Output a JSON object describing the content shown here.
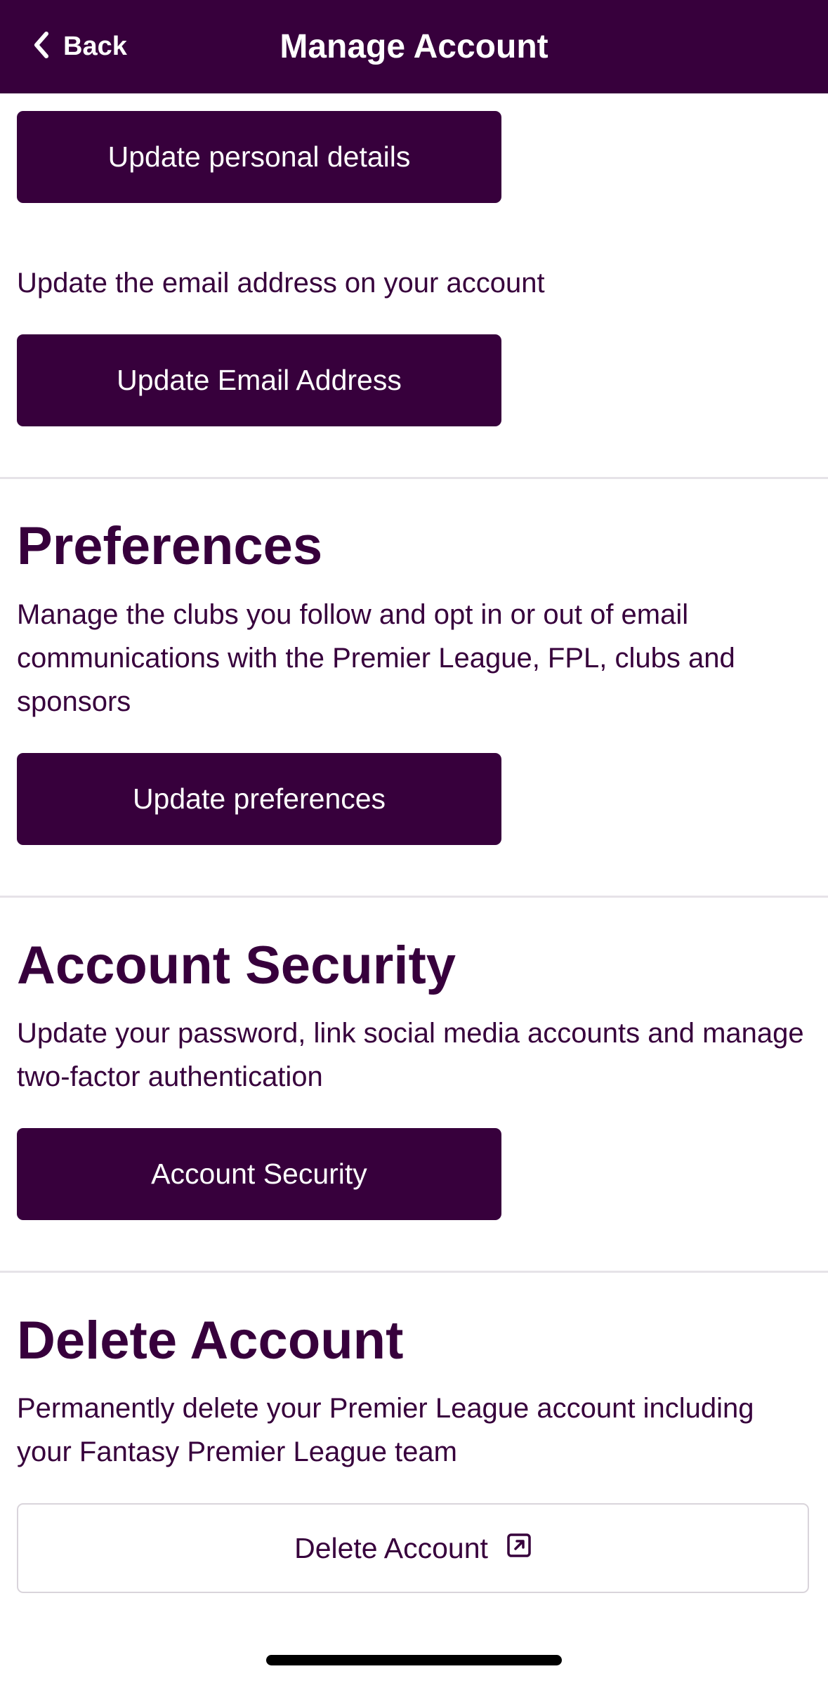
{
  "header": {
    "back_label": "Back",
    "title": "Manage Account"
  },
  "personal": {
    "button_label": "Update personal details"
  },
  "email": {
    "description": "Update the email address on your account",
    "button_label": "Update Email Address"
  },
  "preferences": {
    "title": "Preferences",
    "description": "Manage the clubs you follow and opt in or out of email communications with the Premier League, FPL, clubs and sponsors",
    "button_label": "Update preferences"
  },
  "security": {
    "title": "Account Security",
    "description": "Update your password, link social media accounts and manage two-factor authentication",
    "button_label": "Account Security"
  },
  "delete": {
    "title": "Delete Account",
    "description": "Permanently delete your Premier League account including your Fantasy Premier League team",
    "button_label": "Delete Account",
    "button_icon": "external-link-icon"
  },
  "colors": {
    "brand": "#37003c",
    "background": "#ffffff",
    "divider": "#e6e3e8"
  }
}
